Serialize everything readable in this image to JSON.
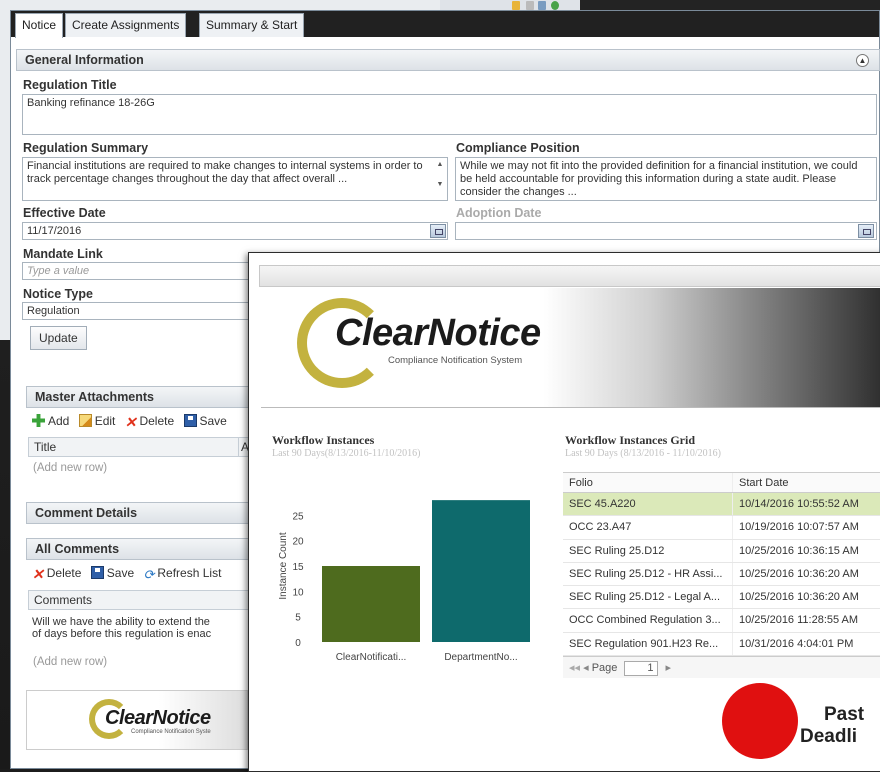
{
  "tabs": [
    {
      "label": "Notice"
    },
    {
      "label": "Create Assignments"
    },
    {
      "label": "Summary & Start"
    }
  ],
  "general": {
    "header": "General Information",
    "regulation_title_label": "Regulation Title",
    "regulation_title_value": "Banking refinance 18-26G",
    "regulation_summary_label": "Regulation Summary",
    "regulation_summary_value": "Financial institutions are required to make changes to internal systems in order to track percentage changes throughout the day that affect overall ...",
    "compliance_position_label": "Compliance Position",
    "compliance_position_value": "While we may not fit into the provided definition for a financial institution, we could be held accountable for providing this information during a state audit.  Please consider the changes ...",
    "effective_date_label": "Effective Date",
    "effective_date_value": "11/17/2016",
    "adoption_date_label": "Adoption Date",
    "adoption_date_value": "",
    "mandate_link_label": "Mandate Link",
    "mandate_link_placeholder": "Type a value",
    "notice_type_label": "Notice Type",
    "notice_type_value": "Regulation",
    "update_button": "Update"
  },
  "attachments": {
    "header": "Master Attachments",
    "toolbar": {
      "add": "Add",
      "edit": "Edit",
      "delete": "Delete",
      "save": "Save"
    },
    "columns": [
      "Title",
      "A"
    ],
    "new_row": "(Add new row)"
  },
  "comment_details": {
    "header": "Comment Details"
  },
  "all_comments": {
    "header": "All Comments",
    "toolbar": {
      "delete": "Delete",
      "save": "Save",
      "refresh": "Refresh List"
    },
    "column": "Comments",
    "comment_line1": "Will we have the ability to extend the",
    "comment_line2": "of days before this regulation is enac",
    "new_row": "(Add new row)"
  },
  "logo_small": {
    "word": "ClearNotice",
    "sub": "Compliance Notification Syste"
  },
  "logo": {
    "word": "ClearNotice",
    "sub": "Compliance Notification System"
  },
  "workflow_chart": {
    "title": "Workflow Instances",
    "subtitle": "Last 90 Days(8/13/2016-11/10/2016)"
  },
  "chart_data": {
    "type": "bar",
    "categories": [
      "ClearNotificati...",
      "DepartmentNo..."
    ],
    "values": [
      15,
      28
    ],
    "ylabel": "Instance Count",
    "yticks": [
      0,
      5,
      10,
      15,
      20,
      25
    ],
    "ylim": [
      0,
      30
    ],
    "colors": [
      "#4e6b1e",
      "#0e6a6c"
    ],
    "grid": false
  },
  "workflow_grid": {
    "title": "Workflow Instances Grid",
    "subtitle": "Last 90 Days (8/13/2016 - 11/10/2016)",
    "columns": [
      "Folio",
      "Start Date"
    ],
    "rows": [
      {
        "folio": "SEC 45.A220",
        "date": "10/14/2016 10:55:52 AM"
      },
      {
        "folio": "OCC 23.A47",
        "date": "10/19/2016 10:07:57 AM"
      },
      {
        "folio": "SEC Ruling 25.D12",
        "date": "10/25/2016 10:36:15 AM"
      },
      {
        "folio": "SEC Ruling 25.D12 - HR Assi...",
        "date": "10/25/2016 10:36:20 AM"
      },
      {
        "folio": "SEC Ruling 25.D12 - Legal A...",
        "date": "10/25/2016 10:36:20 AM"
      },
      {
        "folio": "OCC Combined Regulation 3...",
        "date": "10/25/2016 11:28:55 AM"
      },
      {
        "folio": "SEC Regulation 901.H23 Re...",
        "date": "10/31/2016 4:04:01 PM"
      }
    ],
    "pager_label": "Page",
    "page_value": "1"
  },
  "deadline": {
    "line1": "Past",
    "line2": "Deadli"
  }
}
